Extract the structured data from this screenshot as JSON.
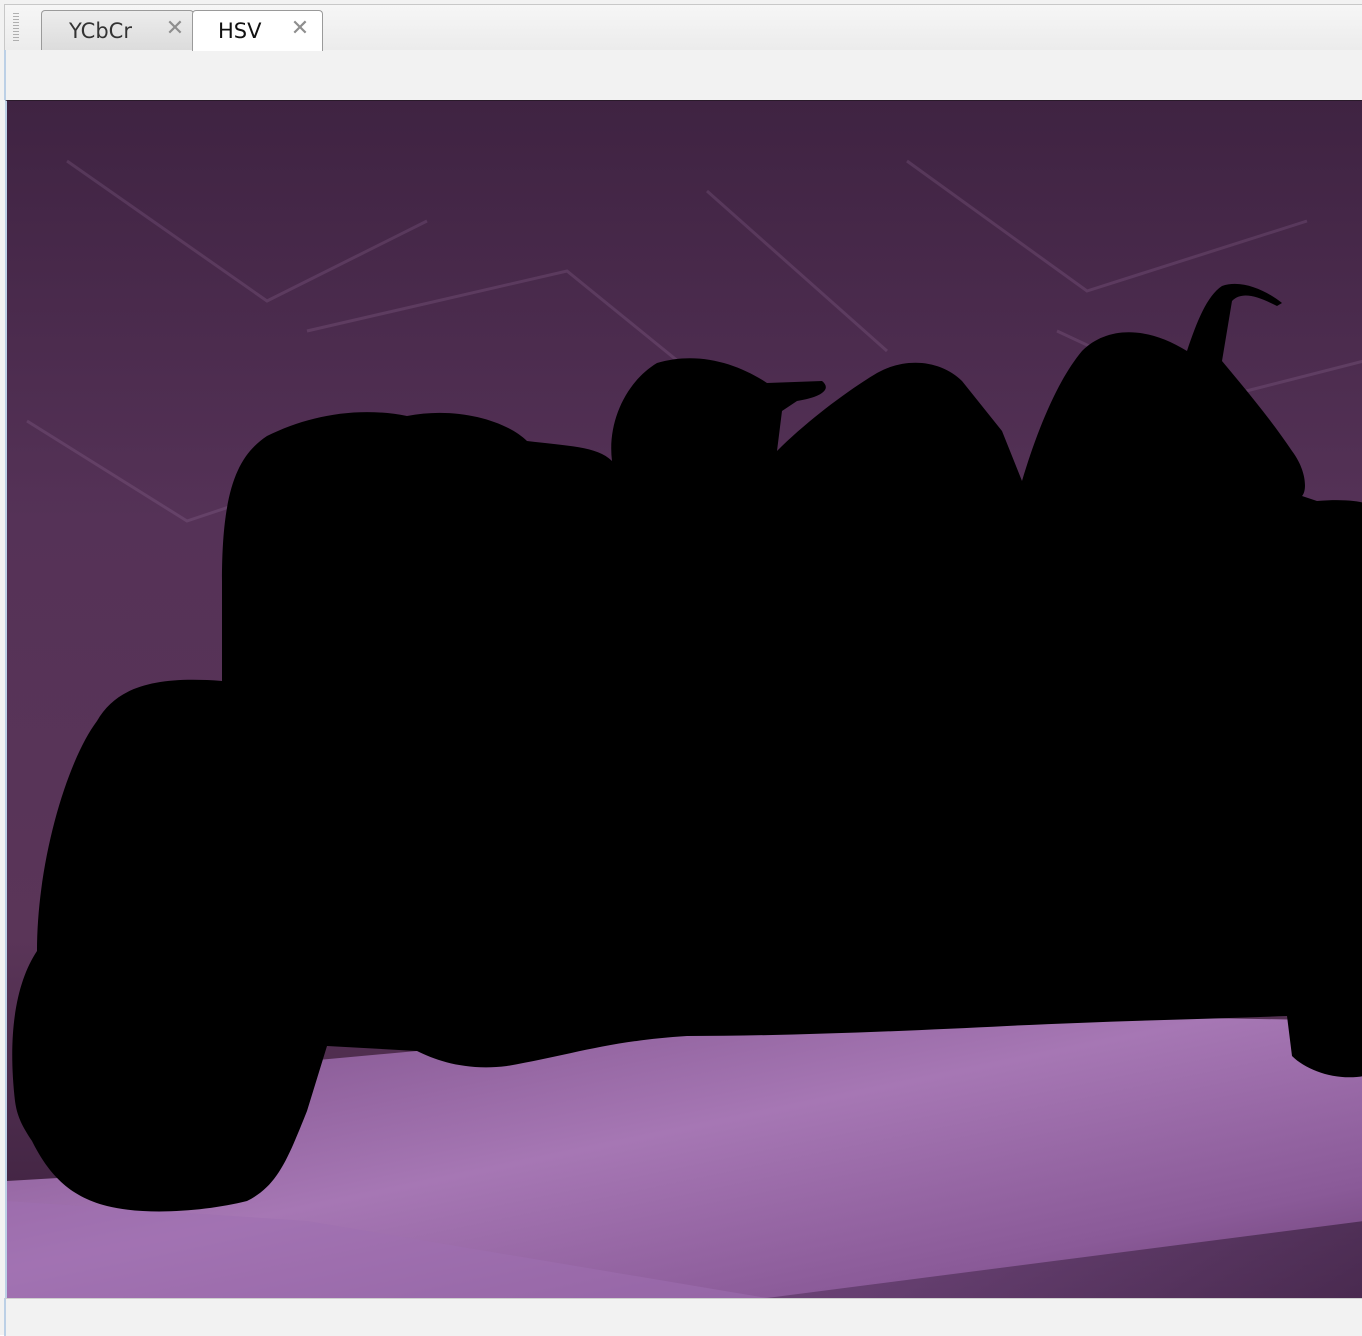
{
  "tabs": [
    {
      "label": "YCbCr",
      "close_glyph": "✕",
      "active": false
    },
    {
      "label": "HSV",
      "close_glyph": "✕",
      "active": true
    }
  ],
  "image": {
    "description_icon": "segmented-image-view",
    "colors": {
      "background_top": "#3f2342",
      "background_mid": "#5a3558",
      "cloth_bottom": "#8a5a98",
      "cloth_bright": "#a677b4",
      "mask": "#000000"
    }
  }
}
